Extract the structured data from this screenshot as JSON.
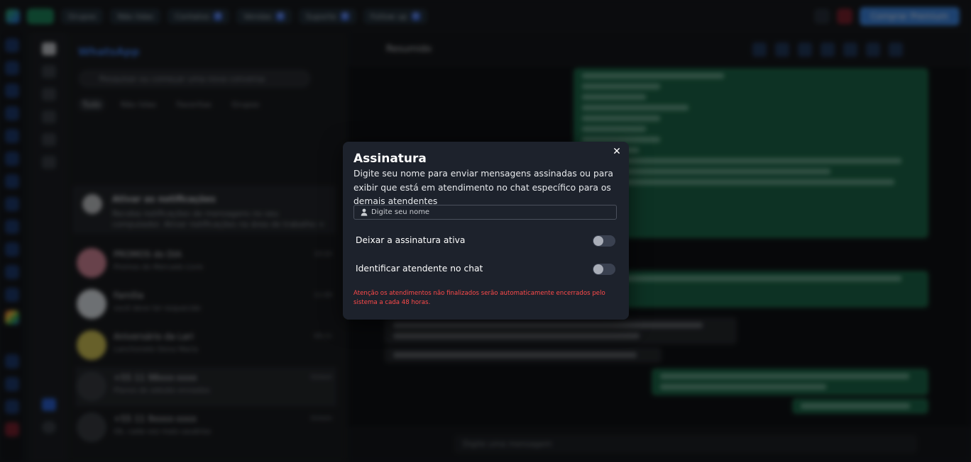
{
  "topbar": {
    "chips": [
      {
        "label": "Grupos"
      },
      {
        "label": "Não lidas"
      },
      {
        "label": "Contatos",
        "count": "0"
      },
      {
        "label": "Vendas",
        "count": "0"
      },
      {
        "label": "Suporte",
        "count": "0"
      },
      {
        "label": "Follow up",
        "count": "0"
      }
    ],
    "premium_label": "Comprar Premium"
  },
  "chatlist": {
    "title": "WhatsApp",
    "search_placeholder": "Pesquisar ou começar uma nova conversa",
    "tabs": [
      "Tudo",
      "Não lidas",
      "Favoritas",
      "Grupos"
    ],
    "notification": {
      "title": "Ativar as notificações",
      "text": "Receba notificações de mensagens no seu computador. Ativar notificações na área de trabalho >"
    },
    "chats": [
      {
        "name": "PROMOS do DIA",
        "message": "Promos do Mercado Livre",
        "time": "10:24"
      },
      {
        "name": "Família",
        "message": "você deve ter esquecido",
        "time": "11:08"
      },
      {
        "name": "Aniversário da Lari",
        "message": "Lanchonete Dona Maria",
        "time": "09:11"
      },
      {
        "name": "+55 11 98xxx-xxxx",
        "message": "Planos de adesão enviados",
        "time": "Ontem"
      },
      {
        "name": "+55 11 9xxxx-xxxx",
        "message": "Ok, cada vez mais usuários",
        "time": "Ontem"
      }
    ]
  },
  "chat": {
    "contact_name": "Resumido",
    "composer_placeholder": "Digite uma mensagem"
  },
  "modal": {
    "title": "Assinatura",
    "description": "Digite seu nome para enviar mensagens assinadas ou para exibir que está em atendimento no chat específico para os demais atendentes",
    "name_placeholder": "Digite seu nome",
    "toggle_active_label": "Deixar a assinatura ativa",
    "toggle_active_value": false,
    "toggle_identify_label": "Identificar atendente no chat",
    "toggle_identify_value": false,
    "warning": "Atenção os atendimentos não finalizados serão automaticamente encerrados pelo sistema a cada 48 horas.",
    "colors": {
      "warning": "#ff4a4a",
      "background": "#1d222c"
    }
  }
}
